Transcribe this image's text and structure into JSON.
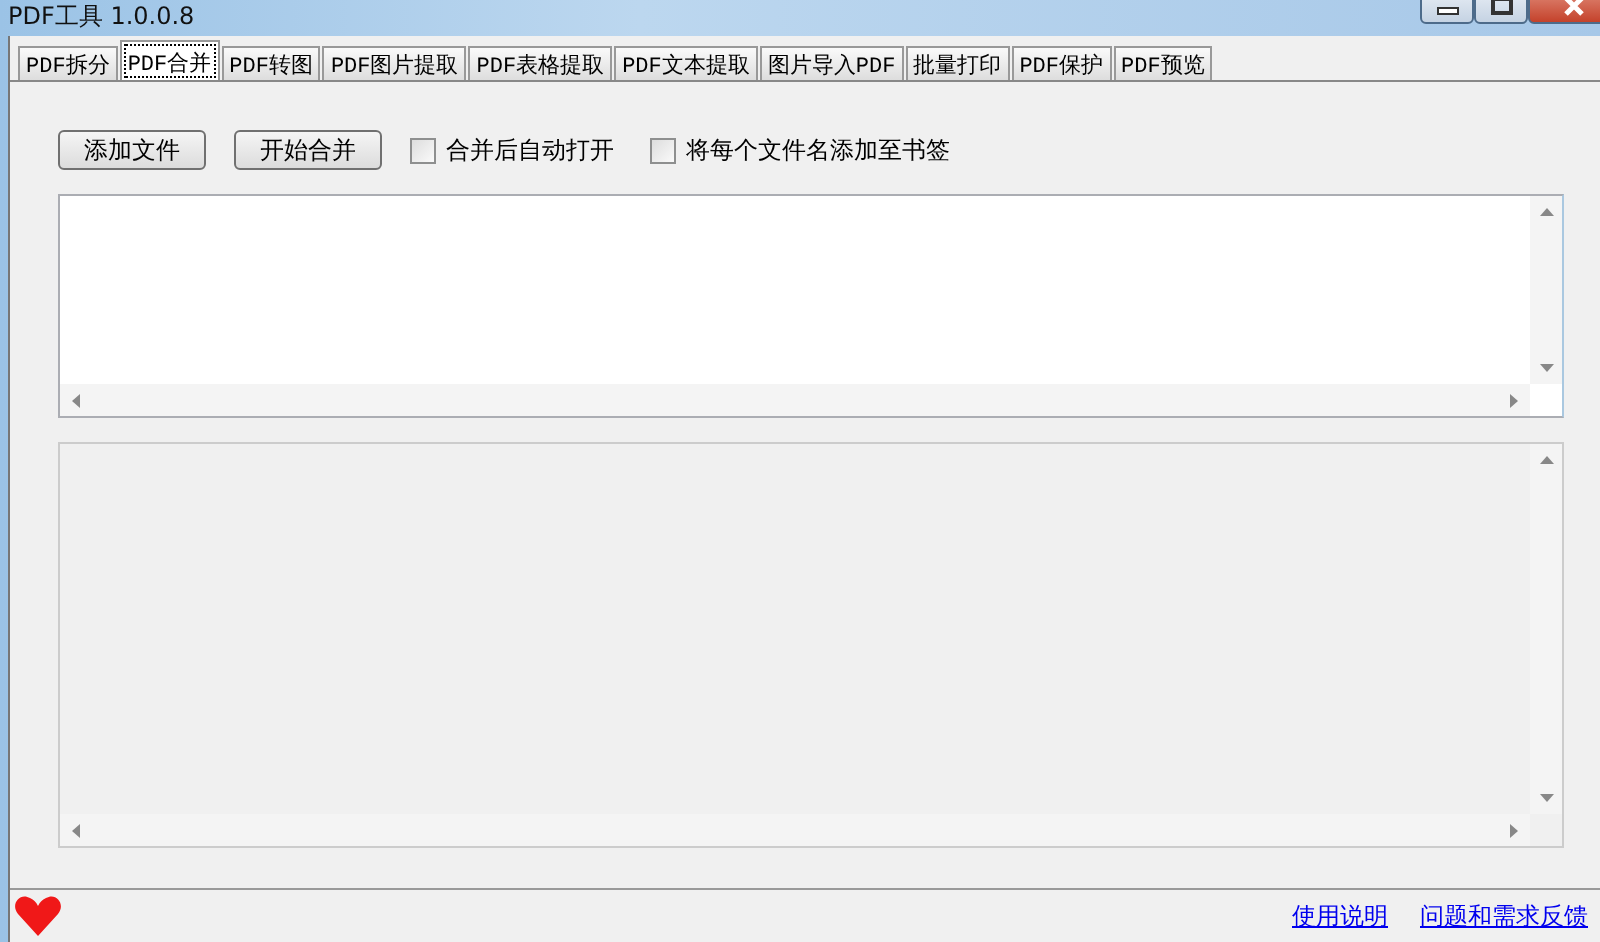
{
  "window": {
    "title": "PDF工具 1.0.0.8"
  },
  "tabs": [
    {
      "label": "PDF拆分",
      "selected": false
    },
    {
      "label": "PDF合并",
      "selected": true
    },
    {
      "label": "PDF转图",
      "selected": false
    },
    {
      "label": "PDF图片提取",
      "selected": false
    },
    {
      "label": "PDF表格提取",
      "selected": false
    },
    {
      "label": "PDF文本提取",
      "selected": false
    },
    {
      "label": "图片导入PDF",
      "selected": false
    },
    {
      "label": "批量打印",
      "selected": false
    },
    {
      "label": "PDF保护",
      "selected": false
    },
    {
      "label": "PDF预览",
      "selected": false
    }
  ],
  "toolbar": {
    "buttons": [
      "添加文件",
      "开始合并"
    ],
    "checkboxes": [
      {
        "label": "合并后自动打开",
        "checked": false
      },
      {
        "label": "将每个文件名添加至书签",
        "checked": false
      }
    ]
  },
  "status_bar": {
    "links": [
      "使用说明",
      "问题和需求反馈"
    ]
  }
}
